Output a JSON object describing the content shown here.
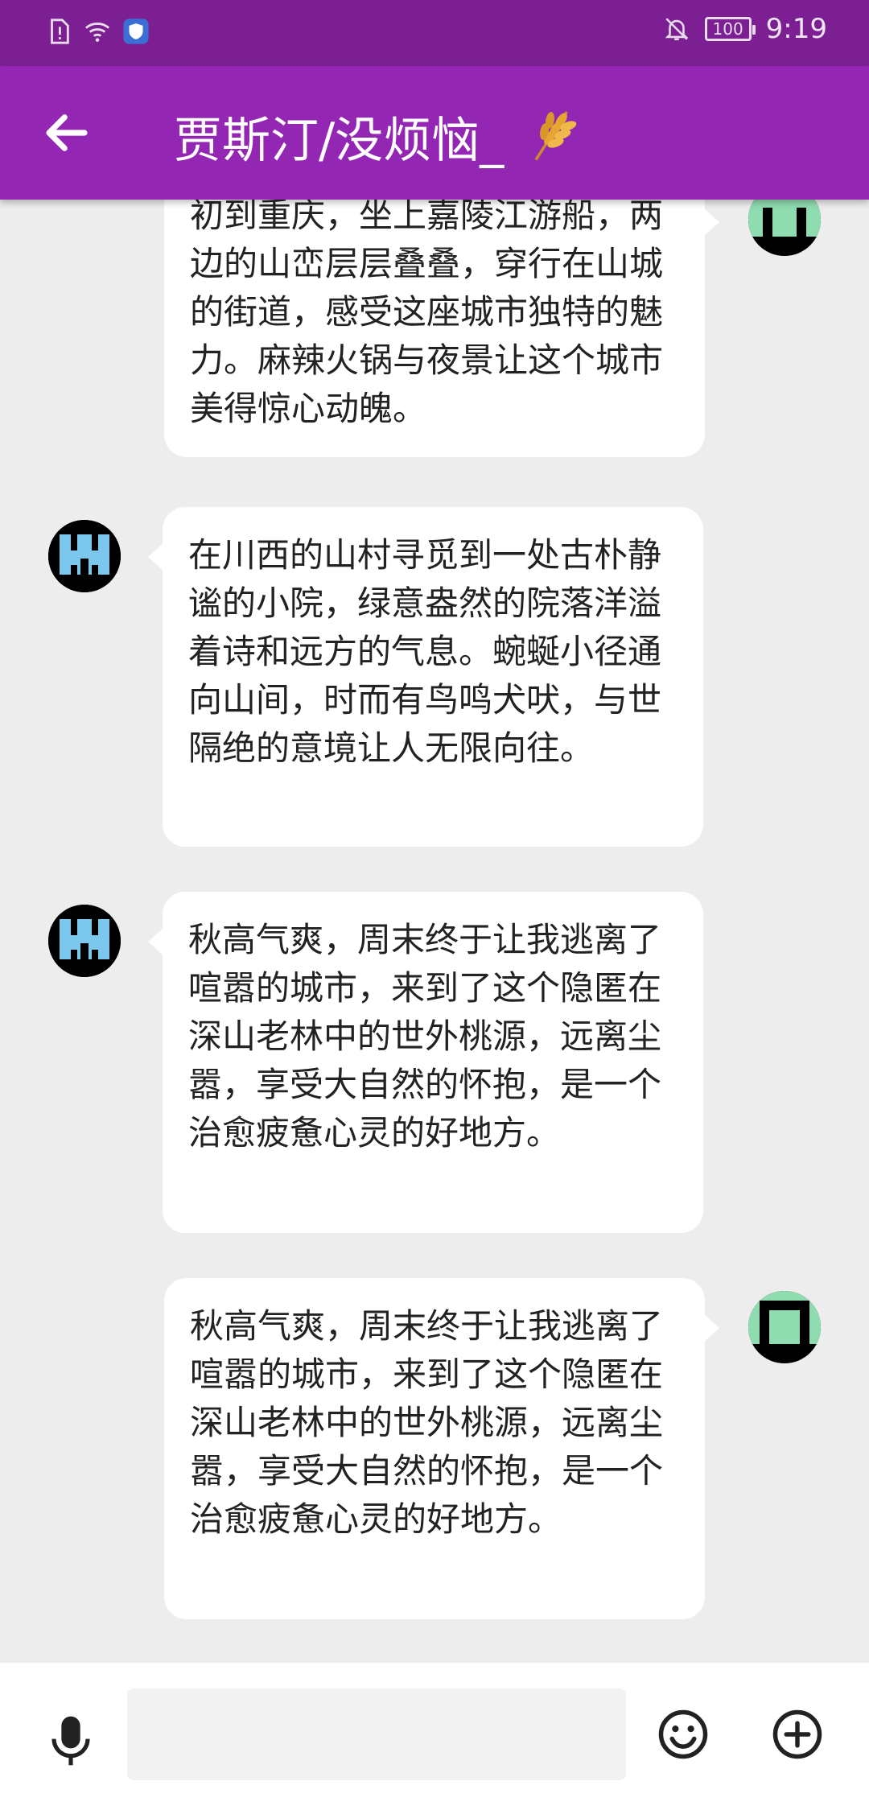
{
  "status_bar": {
    "time": "9:19",
    "battery": "100"
  },
  "header": {
    "title": "贾斯汀/没烦恼_",
    "back_icon": "back-arrow-icon",
    "title_emoji": "wheat-icon"
  },
  "messages": [
    {
      "side": "right",
      "text": "初到重庆，坐上嘉陵江游船，两边的山峦层层叠叠，穿行在山城的街道，感受这座城市独特的魅力。麻辣火锅与夜景让这个城市美得惊心动魄。",
      "avatar_color": "#8fdcb0"
    },
    {
      "side": "left",
      "text": "在川西的山村寻觅到一处古朴静谧的小院，绿意盎然的院落洋溢着诗和远方的气息。蜿蜒小径通向山间，时而有鸟鸣犬吠，与世隔绝的意境让人无限向往。",
      "avatar_color": "#7cc8ec"
    },
    {
      "side": "left",
      "text": "秋高气爽，周末终于让我逃离了喧嚣的城市，来到了这个隐匿在深山老林中的世外桃源，远离尘嚣，享受大自然的怀抱，是一个治愈疲惫心灵的好地方。",
      "avatar_color": "#7cc8ec"
    },
    {
      "side": "right",
      "text": "秋高气爽，周末终于让我逃离了喧嚣的城市，来到了这个隐匿在深山老林中的世外桃源，远离尘嚣，享受大自然的怀抱，是一个治愈疲惫心灵的好地方。",
      "avatar_color": "#8fdcb0"
    }
  ],
  "input_bar": {
    "text_value": "",
    "mic_icon": "microphone-icon",
    "emoji_icon": "emoji-icon",
    "plus_icon": "plus-circle-icon"
  },
  "colors": {
    "status_bar": "#7b1f92",
    "app_bar": "#9327b3",
    "background": "#ededed",
    "bubble": "#ffffff"
  }
}
